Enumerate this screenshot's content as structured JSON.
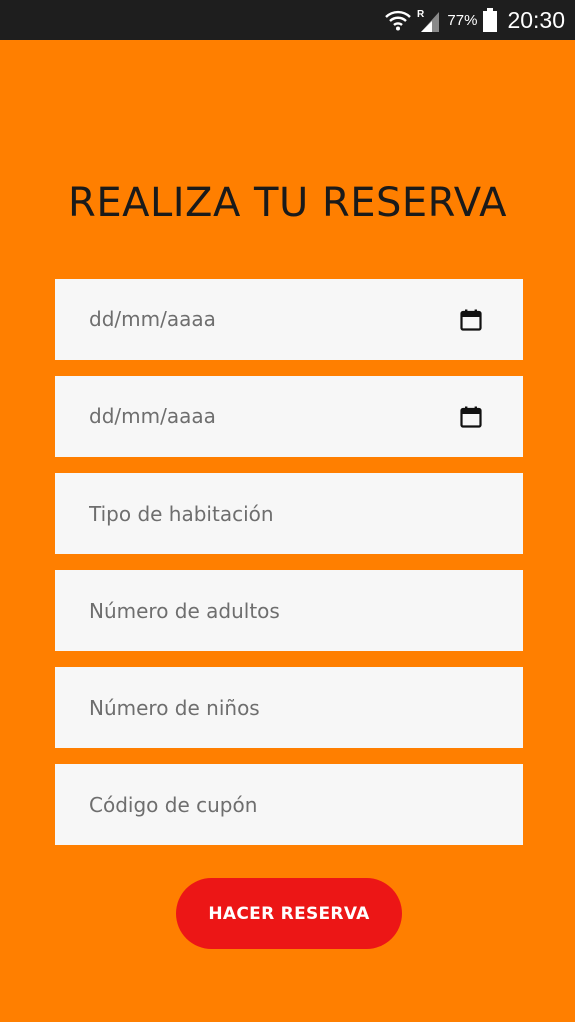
{
  "status_bar": {
    "battery_percent": "77%",
    "time": "20:30",
    "icons": [
      "wifi-icon",
      "signal-roaming-icon",
      "battery-icon"
    ]
  },
  "title": "REALIZA TU RESERVA",
  "form": {
    "check_in": {
      "placeholder": "dd/mm/aaaa",
      "icon": "calendar-icon"
    },
    "check_out": {
      "placeholder": "dd/mm/aaaa",
      "icon": "calendar-icon"
    },
    "room_type": {
      "placeholder": "Tipo de habitación"
    },
    "adults": {
      "placeholder": "Número de adultos"
    },
    "children": {
      "placeholder": "Número de niños"
    },
    "coupon": {
      "placeholder": "Código de cupón"
    }
  },
  "submit_label": "HACER RESERVA",
  "colors": {
    "background": "#ff7f00",
    "status_bar": "#1e1e1e",
    "field": "#f7f7f7",
    "button": "#ec1616",
    "title": "#1a1a1a"
  }
}
